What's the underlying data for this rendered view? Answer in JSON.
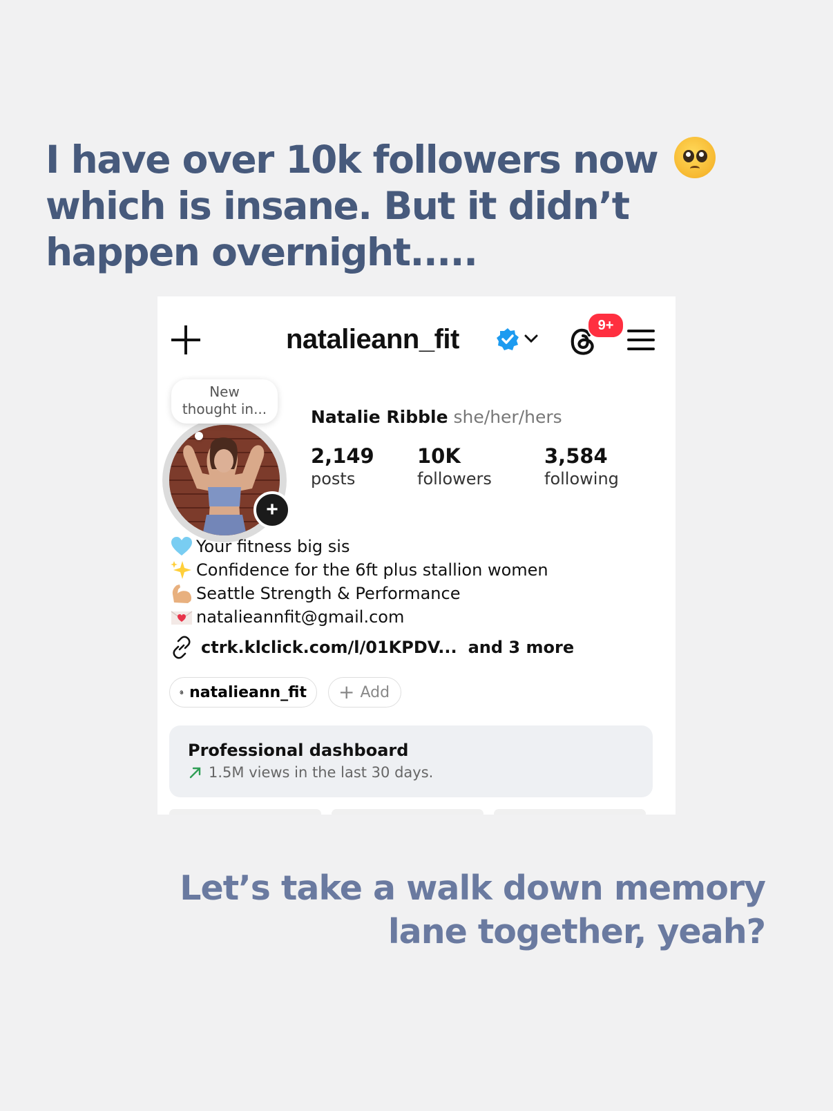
{
  "headline": {
    "line1": "I have over 10k followers now",
    "line2": "which is insane. But it didn’t",
    "line3": "happen overnight.....",
    "emoji": "pleading-face-emoji"
  },
  "profile": {
    "username": "natalieann_fit",
    "notification_badge": "9+",
    "thought_bubble": {
      "line1": "New",
      "line2": "thought in..."
    },
    "full_name": "Natalie Ribble",
    "pronouns": "she/her/hers",
    "stats": [
      {
        "value": "2,149",
        "label": "posts"
      },
      {
        "value": "10K",
        "label": "followers"
      },
      {
        "value": "3,584",
        "label": "following"
      }
    ],
    "bio": [
      {
        "icon": "blue-heart-icon",
        "text": "Your fitness big sis"
      },
      {
        "icon": "sparkles-icon",
        "text": " Confidence for the 6ft plus stallion women"
      },
      {
        "icon": "flexed-biceps-icon",
        "text": "Seattle Strength & Performance"
      },
      {
        "icon": "love-letter-icon",
        "text": " natalieannfit@gmail.com"
      }
    ],
    "link": {
      "url": "ctrk.klclick.com/l/01KPDV...",
      "more": "and 3 more"
    },
    "threads_pill": "natalieann_fit",
    "add_pill": "Add",
    "dashboard": {
      "title": "Professional dashboard",
      "subtitle": "1.5M views in the last 30 days."
    }
  },
  "footer": {
    "line1": "Let’s take a walk down memory",
    "line2": "lane together, yeah?"
  },
  "colors": {
    "headline": "#475a7c",
    "footer": "#6a7aa0",
    "background": "#f1f1f2",
    "badge": "#ff2f40",
    "verified": "#1d9bf0"
  }
}
